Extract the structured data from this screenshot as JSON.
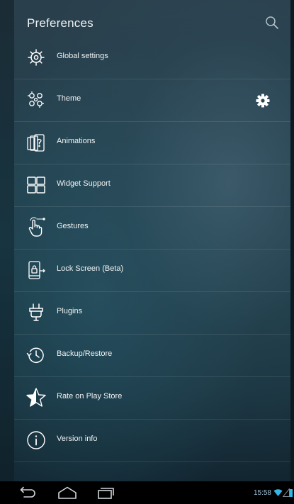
{
  "header": {
    "title": "Preferences",
    "search_icon": "search-icon"
  },
  "items": [
    {
      "label": "Global settings",
      "icon": "globe-gear-icon"
    },
    {
      "label": "Theme",
      "icon": "theme-icon",
      "action_icon": "gear-icon"
    },
    {
      "label": "Animations",
      "icon": "animations-icon"
    },
    {
      "label": "Widget Support",
      "icon": "widget-icon"
    },
    {
      "label": "Gestures",
      "icon": "gesture-hand-icon"
    },
    {
      "label": "Lock Screen (Beta)",
      "icon": "lock-screen-icon"
    },
    {
      "label": "Plugins",
      "icon": "plug-icon"
    },
    {
      "label": "Backup/Restore",
      "icon": "backup-restore-icon"
    },
    {
      "label": "Rate on Play Store",
      "icon": "star-icon"
    },
    {
      "label": "Version info",
      "icon": "info-icon"
    }
  ],
  "navbar": {
    "back_icon": "back-icon",
    "home_icon": "home-icon",
    "recents_icon": "recents-icon"
  },
  "status_bar": {
    "time": "15:58",
    "icons": [
      "wifi-icon",
      "signal-icon",
      "battery-icon"
    ]
  },
  "colors": {
    "panel_top": "#2a3f4c",
    "panel_bottom": "#122530",
    "clock": "#9fc4da"
  }
}
